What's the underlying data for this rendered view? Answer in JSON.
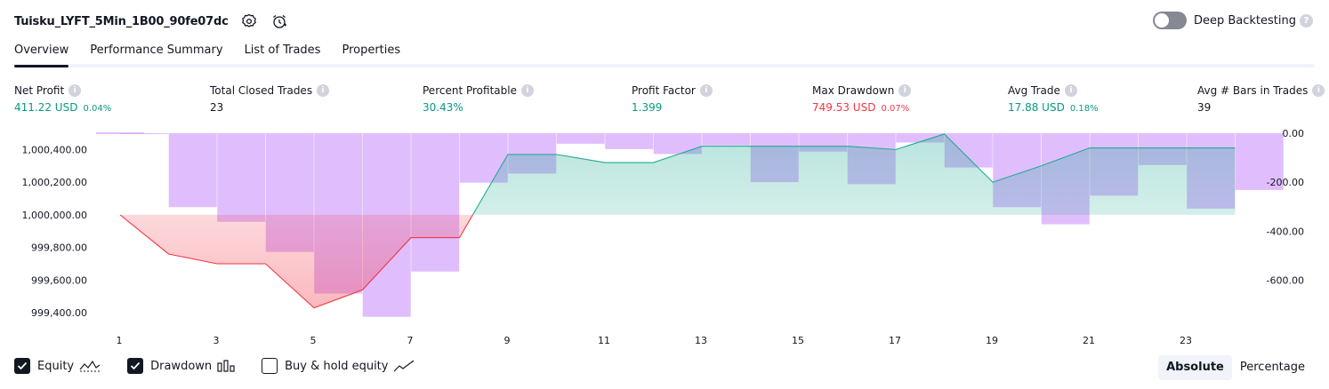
{
  "header": {
    "strategy_name": "Tuisku_LYFT_5Min_1B00_90fe07dc",
    "icons": [
      "settings-icon",
      "add-alert-icon"
    ],
    "deep_backtesting_label": "Deep Backtesting",
    "deep_backtesting_enabled": false,
    "help_icon": "?"
  },
  "tabs": [
    {
      "label": "Overview",
      "active": true
    },
    {
      "label": "Performance Summary",
      "active": false
    },
    {
      "label": "List of Trades",
      "active": false
    },
    {
      "label": "Properties",
      "active": false
    }
  ],
  "metrics": [
    {
      "label": "Net Profit",
      "value": "411.22 USD",
      "pct": "0.04%",
      "color": "#089981"
    },
    {
      "label": "Total Closed Trades",
      "value": "23",
      "pct": "",
      "color": "#131722"
    },
    {
      "label": "Percent Profitable",
      "value": "30.43%",
      "pct": "",
      "color": "#089981"
    },
    {
      "label": "Profit Factor",
      "value": "1.399",
      "pct": "",
      "color": "#089981"
    },
    {
      "label": "Max Drawdown",
      "value": "749.53 USD",
      "pct": "0.07%",
      "color": "#f23645"
    },
    {
      "label": "Avg Trade",
      "value": "17.88 USD",
      "pct": "0.18%",
      "color": "#089981"
    },
    {
      "label": "Avg # Bars in Trades",
      "value": "39",
      "pct": "",
      "color": "#131722"
    }
  ],
  "chart_data": {
    "type": "line",
    "equity_baseline": 1000000,
    "left_axis": {
      "ticks": [
        "1,000,400.00",
        "1,000,200.00",
        "1,000,000.00",
        "999,800.00",
        "999,600.00",
        "999,400.00"
      ],
      "values": [
        1000400,
        1000200,
        1000000,
        999800,
        999600,
        999400
      ],
      "range": [
        999330,
        1000500
      ]
    },
    "right_axis": {
      "ticks": [
        "0.00",
        "-200.00",
        "-400.00",
        "-600.00"
      ],
      "values": [
        0,
        -200,
        -400,
        -600
      ],
      "range": [
        -780,
        0
      ]
    },
    "x_ticks": [
      "1",
      "3",
      "5",
      "7",
      "9",
      "11",
      "13",
      "15",
      "17",
      "19",
      "21",
      "23"
    ],
    "x_tick_values": [
      1,
      3,
      5,
      7,
      9,
      11,
      13,
      15,
      17,
      19,
      21,
      23
    ],
    "series": [
      {
        "name": "Equity",
        "x": [
          1,
          2,
          3,
          4,
          5,
          6,
          7,
          8,
          9,
          10,
          11,
          12,
          13,
          14,
          15,
          16,
          17,
          18,
          19,
          20,
          21,
          22,
          23,
          24
        ],
        "y": [
          1000000,
          999760,
          999700,
          999700,
          999430,
          999540,
          999860,
          999860,
          1000370,
          1000370,
          1000320,
          1000320,
          1000420,
          1000420,
          1000420,
          1000420,
          1000400,
          1000495,
          1000200,
          1000300,
          1000410,
          1000410,
          1000410,
          1000410
        ]
      },
      {
        "name": "Drawdown",
        "x": [
          1,
          2,
          3,
          4,
          5,
          6,
          7,
          8,
          9,
          10,
          11,
          12,
          13,
          14,
          15,
          16,
          17,
          18,
          19,
          20,
          21,
          22,
          23,
          24
        ],
        "y": [
          -2,
          -302,
          -362,
          -485,
          -655,
          -750,
          -565,
          -202,
          -165,
          -43,
          -65,
          -85,
          -50,
          -200,
          -75,
          -208,
          -38,
          -140,
          -302,
          -372,
          -255,
          -130,
          -308,
          -232
        ]
      }
    ],
    "colors": {
      "equity_up": "#22ab94",
      "equity_down": "#f23645",
      "drawdown": "#cf9bfc"
    }
  },
  "legend": {
    "items": [
      {
        "label": "Equity",
        "checked": true,
        "icon": "equity-line-icon"
      },
      {
        "label": "Drawdown",
        "checked": true,
        "icon": "drawdown-bars-icon"
      },
      {
        "label": "Buy & hold equity",
        "checked": false,
        "icon": "buy-hold-line-icon"
      }
    ]
  },
  "mode": {
    "options": [
      "Absolute",
      "Percentage"
    ],
    "selected": "Absolute"
  }
}
